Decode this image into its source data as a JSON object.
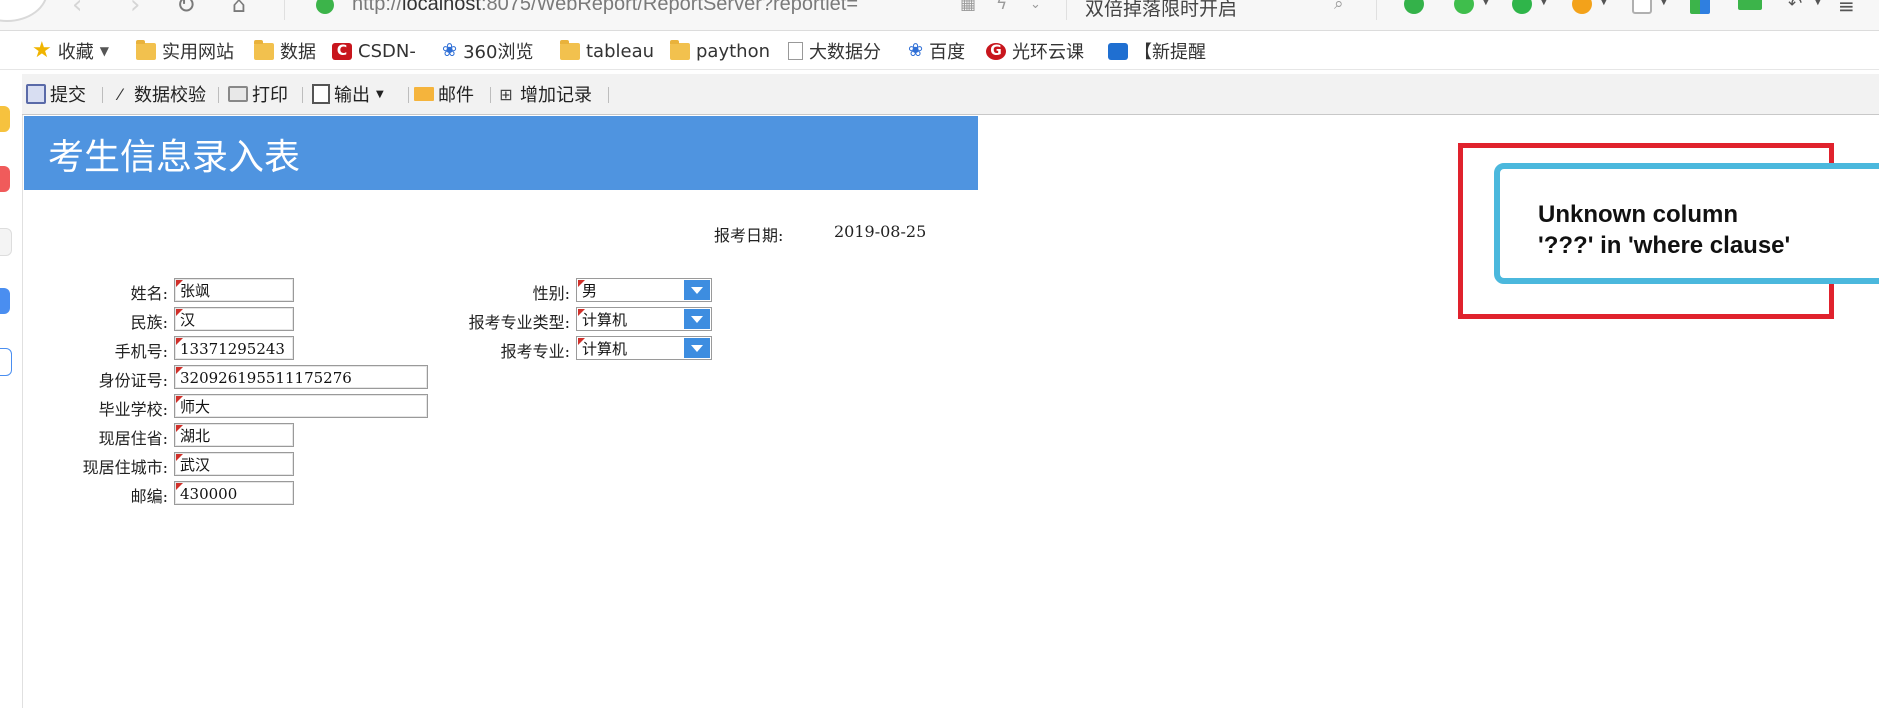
{
  "browser": {
    "url_prefix": "http://",
    "url_host": "localhost",
    "url_rest": ":8075/WebReport/ReportServer?reportlet=",
    "search_text": "双倍掉落限时开启"
  },
  "bookmarks": [
    {
      "label": "收藏",
      "icon": "star-icon"
    },
    {
      "label": "实用网站",
      "icon": "folder-icon"
    },
    {
      "label": "数据",
      "icon": "folder-icon"
    },
    {
      "label": "CSDN-",
      "icon": "csdn-icon"
    },
    {
      "label": "360浏览",
      "icon": "baidu-paw-icon"
    },
    {
      "label": "tableau",
      "icon": "folder-icon"
    },
    {
      "label": "paython",
      "icon": "folder-icon"
    },
    {
      "label": "大数据分",
      "icon": "page-icon"
    },
    {
      "label": "百度",
      "icon": "baidu-paw-icon"
    },
    {
      "label": "光环云课",
      "icon": "guanghuan-icon"
    },
    {
      "label": "【新提醒",
      "icon": "app-icon"
    }
  ],
  "toolbar": {
    "submit": "提交",
    "validate": "数据校验",
    "print": "打印",
    "export": "输出",
    "mail": "邮件",
    "add_record": "增加记录"
  },
  "report": {
    "title": "考生信息录入表",
    "date_label": "报考日期:",
    "date_value": "2019-08-25"
  },
  "form": {
    "name": {
      "label": "姓名:",
      "value": "张飒"
    },
    "ethnicity": {
      "label": "民族:",
      "value": "汉"
    },
    "phone": {
      "label": "手机号:",
      "value": "13371295243"
    },
    "id_number": {
      "label": "身份证号:",
      "value": "320926195511175276"
    },
    "school": {
      "label": "毕业学校:",
      "value": "师大"
    },
    "province": {
      "label": "现居住省:",
      "value": "湖北"
    },
    "city": {
      "label": "现居住城市:",
      "value": "武汉"
    },
    "postcode": {
      "label": "邮编:",
      "value": "430000"
    },
    "gender": {
      "label": "性别:",
      "value": "男"
    },
    "major_type": {
      "label": "报考专业类型:",
      "value": "计算机"
    },
    "major": {
      "label": "报考专业:",
      "value": "计算机"
    }
  },
  "error": {
    "line1": "Unknown column",
    "line2": "'???' in 'where clause'",
    "frame_color": "#e0222d",
    "bubble_color": "#4bb8dd"
  },
  "colors": {
    "header_blue": "#4f94e0",
    "dropdown_blue": "#3d8de0",
    "required_marker": "#d0302a"
  }
}
